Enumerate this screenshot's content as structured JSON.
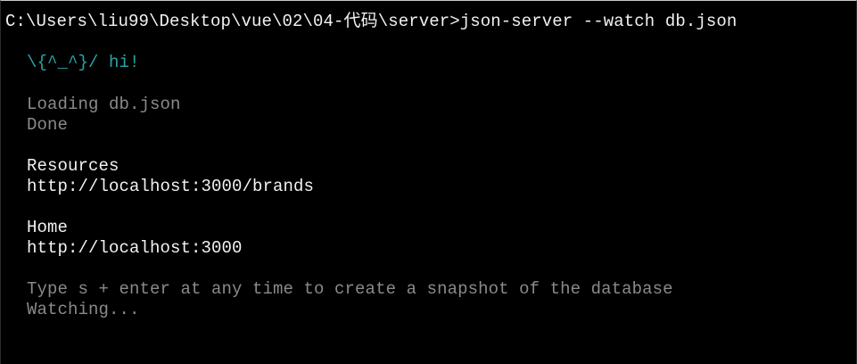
{
  "terminal": {
    "prompt_line": "C:\\Users\\liu99\\Desktop\\vue\\02\\04-代码\\server>json-server --watch db.json",
    "banner": "\\{^_^}/ hi!",
    "loading": "Loading db.json",
    "done": "Done",
    "resources_heading": "Resources",
    "resources_url": "http://localhost:3000/brands",
    "home_heading": "Home",
    "home_url": "http://localhost:3000",
    "snapshot_hint": "Type s + enter at any time to create a snapshot of the database",
    "watching": "Watching..."
  },
  "colors": {
    "background": "#000000",
    "text": "#f2f2f2",
    "muted": "#8a8a8a",
    "banner": "#2aa3a8"
  }
}
